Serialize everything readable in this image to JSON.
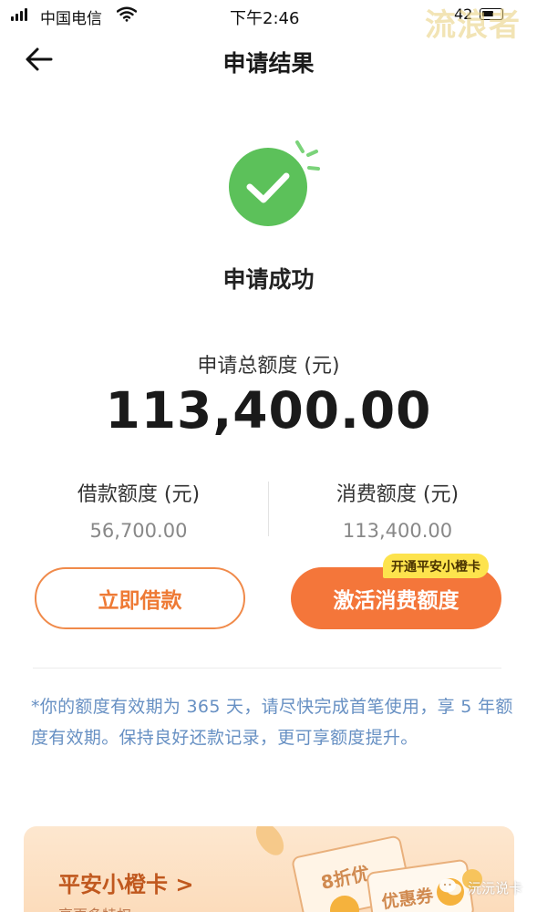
{
  "status_bar": {
    "carrier": "中国电信",
    "time": "下午2:46",
    "battery": "42"
  },
  "watermark": {
    "top_right": "流浪者",
    "bottom_right": "沅沅说卡"
  },
  "nav": {
    "title": "申请结果",
    "back_icon": "back-arrow-icon"
  },
  "result": {
    "status_icon": "check-circle-icon",
    "status_text": "申请成功",
    "total_label": "申请总额度 (元)",
    "total_value": "113,400.00",
    "loan_label": "借款额度 (元)",
    "loan_value": "56,700.00",
    "consume_label": "消费额度 (元)",
    "consume_value": "113,400.00"
  },
  "actions": {
    "borrow_button": "立即借款",
    "activate_button": "激活消费额度",
    "promo_tag": "开通平安小橙卡"
  },
  "notice": "*你的额度有效期为 365 天，请尽快完成首笔使用，享 5 年额度有效期。保持良好还款记录，更可享额度提升。",
  "card": {
    "title": "平安小橙卡 >",
    "subtitle": "享更多特权",
    "coupon_discount": "8折优",
    "coupon_label": "优惠券"
  },
  "colors": {
    "accent_orange": "#f4763a",
    "success_green": "#5cc15a",
    "notice_blue": "#6790c3",
    "tag_yellow": "#fde34d"
  }
}
